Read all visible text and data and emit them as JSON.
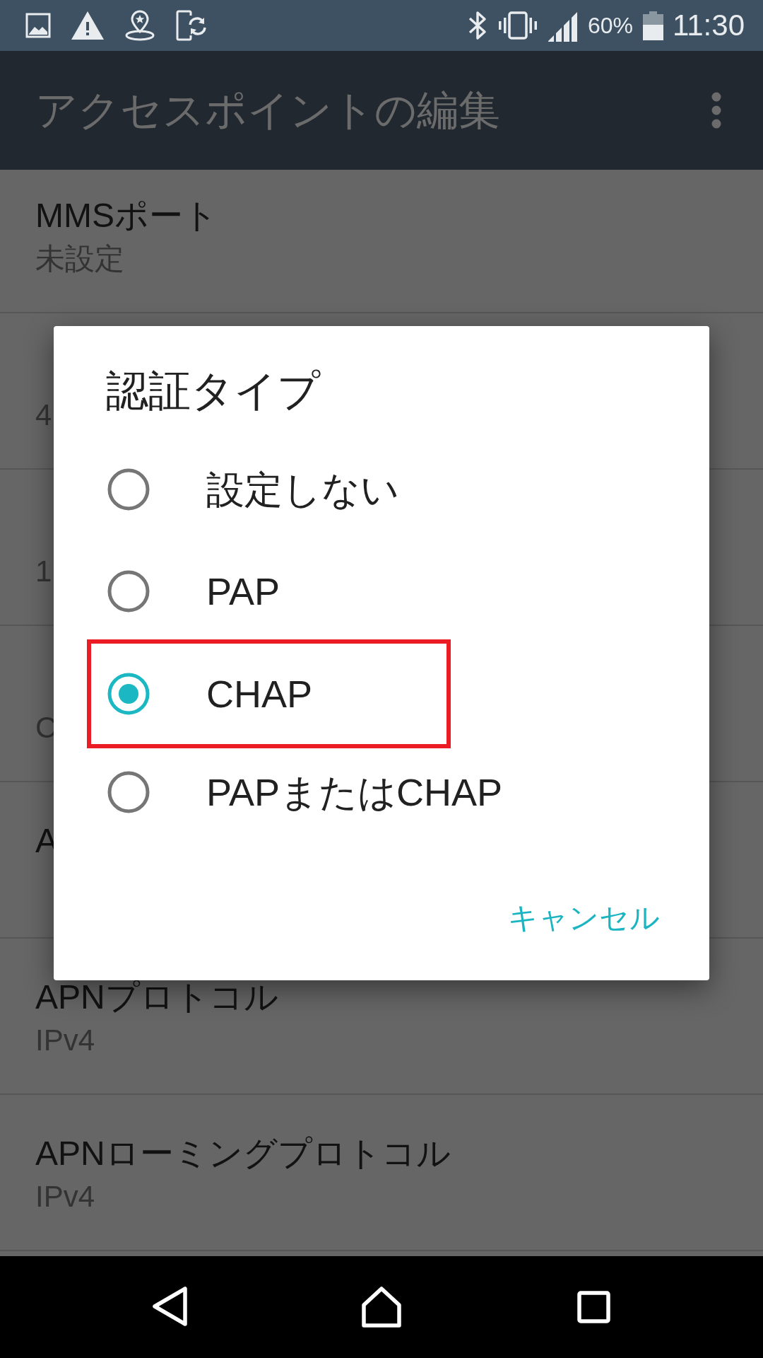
{
  "status_bar": {
    "battery": "60%",
    "time": "11:30"
  },
  "app_bar": {
    "title": "アクセスポイントの編集"
  },
  "settings_list": [
    {
      "title": "MMSポート",
      "summary": "未設定"
    },
    {
      "summary": "4"
    },
    {
      "summary": "1"
    },
    {
      "summary": "C"
    },
    {
      "title": "A"
    },
    {
      "title": "APNプロトコル",
      "summary": "IPv4"
    },
    {
      "title": "APNローミングプロトコル",
      "summary": "IPv4"
    }
  ],
  "dialog": {
    "title": "認証タイプ",
    "options": [
      {
        "label": "設定しない",
        "selected": false,
        "highlighted": false
      },
      {
        "label": "PAP",
        "selected": false,
        "highlighted": false
      },
      {
        "label": "CHAP",
        "selected": true,
        "highlighted": true
      },
      {
        "label": "PAPまたはCHAP",
        "selected": false,
        "highlighted": false
      }
    ],
    "buttons": [
      "キャンセル"
    ]
  }
}
